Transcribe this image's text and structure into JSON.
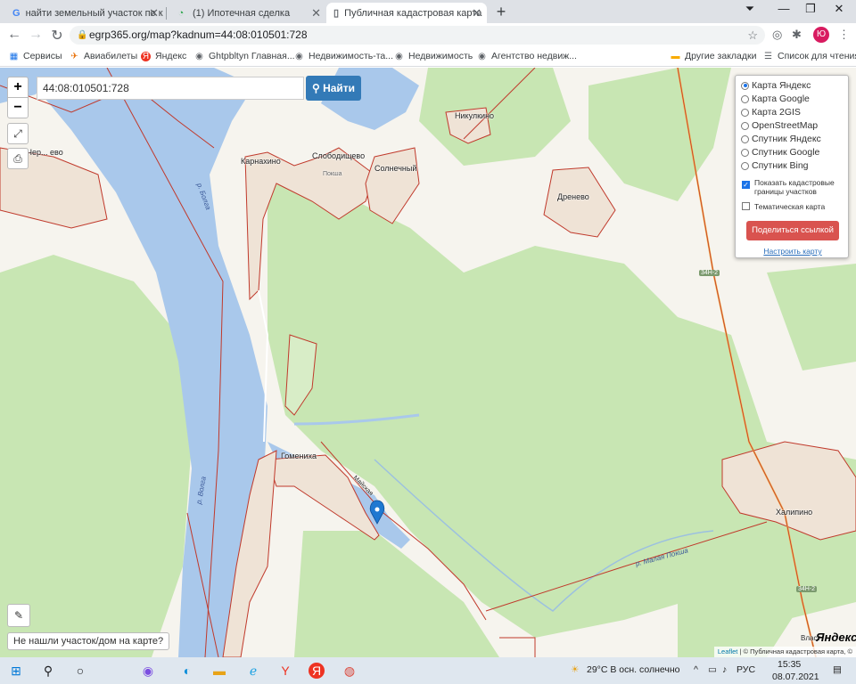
{
  "browser": {
    "tabs": [
      {
        "title": "найти земельный участок по к",
        "icon": "google-icon"
      },
      {
        "title": "(1) Ипотечная сделка",
        "icon": "chat-icon"
      },
      {
        "title": "Публичная кадастровая карта",
        "icon": "page-icon",
        "active": true
      }
    ],
    "url": "egrp365.org/map?kadnum=44:08:010501:728",
    "avatar_letter": "Ю",
    "bookmarks": [
      "Сервисы",
      "Авиабилеты",
      "Яндекс",
      "Ghtpbltyn Главная...",
      "Недвижимость-та...",
      "Недвижимость",
      "Агентство недвиж..."
    ],
    "bookmarks_right": [
      "Другие закладки",
      "Список для чтения"
    ]
  },
  "map": {
    "search_value": "44:08:010501:728",
    "find_label": "Найти",
    "zoom_in": "+",
    "zoom_out": "−",
    "layers": {
      "options": [
        "Карта Яндекс",
        "Карта Google",
        "Карта 2GIS",
        "OpenStreetMap",
        "Спутник Яндекс",
        "Спутник Google",
        "Спутник Bing"
      ],
      "selected": "Карта Яндекс",
      "show_cadastral": "Показать кадастровые границы участков",
      "show_cadastral_checked": true,
      "thematic": "Тематическая карта",
      "thematic_checked": false,
      "share": "Поделиться ссылкой",
      "configure": "Настроить карту"
    },
    "labels": {
      "karnakhino": "Карнахино",
      "slobodishchevo": "Слободищево",
      "solnechny": "Солнечный",
      "nikulkino": "Никулкино",
      "drenevo": "Дренево",
      "gomenikha": "Гоменихa",
      "khalipino": "Халипино",
      "chernyshevo": "Чер... ево",
      "pokha": "Покша",
      "maiskaya": "Майская",
      "vlast": "Власт",
      "river_volga": "р. Волга",
      "river_bolga": "р. Болга",
      "river_malaya_poksha": "р. Малая Покша",
      "road_1": "34Н-2",
      "road_2": "34Н-2"
    },
    "not_found": "Не нашли участок/дом на карте?",
    "attribution_leaflet": "Leaflet",
    "attribution_rest": "| © Публичная кадастровая карта, ©",
    "yandex_logo": "Яндекс",
    "colors": {
      "water": "#a9c8eb",
      "forest": "#c8e6b3",
      "field": "#f6f4ee",
      "boundary": "#c0392b",
      "marker": "#1f78d1"
    }
  },
  "taskbar": {
    "weather": "29°C  В осн. солнечно",
    "lang": "РУС",
    "time": "15:35",
    "date": "08.07.2021"
  }
}
